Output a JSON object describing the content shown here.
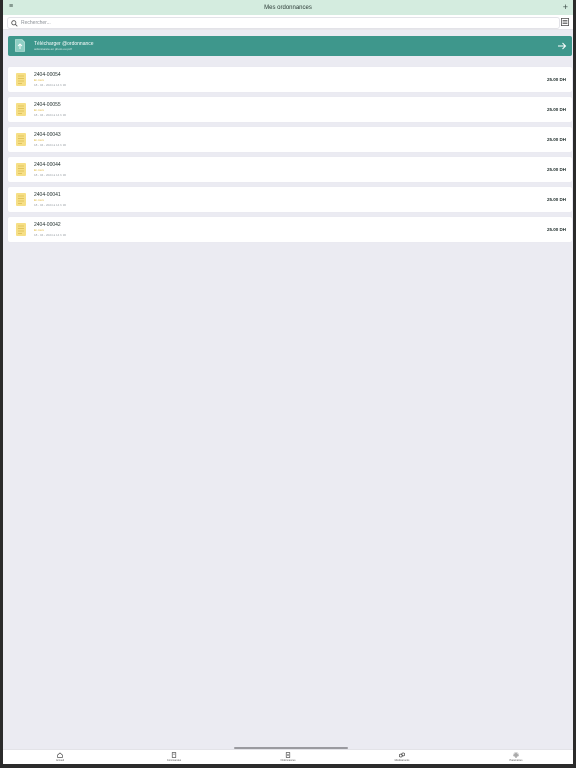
{
  "header": {
    "title": "Mes ordonnances"
  },
  "search": {
    "placeholder": "Rechercher..."
  },
  "banner": {
    "title": "Télécharger @ordonnance",
    "subtitle": "ordonnance en photo ou pdf"
  },
  "prescriptions": [
    {
      "number": "2404-00054",
      "status": "En cours",
      "meta": "18 - 04 - 2024 à 14 h 30",
      "price": "25.00 DH"
    },
    {
      "number": "2404-00055",
      "status": "En cours",
      "meta": "18 - 04 - 2024 à 14 h 30",
      "price": "25.00 DH"
    },
    {
      "number": "2404-00043",
      "status": "En cours",
      "meta": "18 - 04 - 2024 à 14 h 30",
      "price": "25.00 DH"
    },
    {
      "number": "2404-00044",
      "status": "En cours",
      "meta": "18 - 04 - 2024 à 14 h 30",
      "price": "25.00 DH"
    },
    {
      "number": "2404-00041",
      "status": "En cours",
      "meta": "18 - 04 - 2024 à 14 h 30",
      "price": "25.00 DH"
    },
    {
      "number": "2404-00042",
      "status": "En cours",
      "meta": "18 - 04 - 2024 à 14 h 30",
      "price": "25.00 DH"
    }
  ],
  "tabs": [
    {
      "label": "Accueil",
      "icon": "home-icon"
    },
    {
      "label": "Commandes",
      "icon": "orders-icon"
    },
    {
      "label": "Ordonnances",
      "icon": "prescription-icon"
    },
    {
      "label": "Médicaments",
      "icon": "pills-icon"
    },
    {
      "label": "Paramètres",
      "icon": "gear-icon"
    }
  ],
  "colors": {
    "header_bg": "#d4ecdf",
    "accent": "#3e978c",
    "status": "#e2b83a",
    "doc_icon": "#f6df86"
  }
}
